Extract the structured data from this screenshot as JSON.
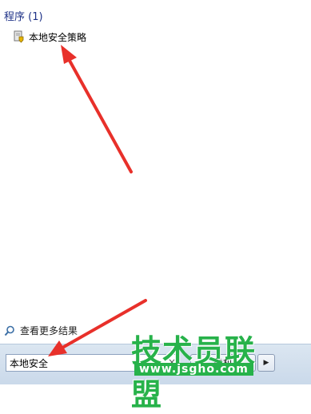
{
  "results": {
    "group_header": "程序 (1)",
    "items": [
      {
        "label": "本地安全策略",
        "icon": "security-policy-icon"
      }
    ]
  },
  "see_more": {
    "label": "查看更多结果",
    "icon": "search-icon"
  },
  "search": {
    "value": "本地安全",
    "clear_icon": "×"
  },
  "bottom": {
    "shutdown_label": "关机",
    "arrow_label": "▶"
  },
  "watermark": {
    "title": "技术员联盟",
    "url": "www.jsgho.com"
  },
  "colors": {
    "header": "#1e3287",
    "annotation": "#e8302a",
    "watermark_green": "#27b24a"
  }
}
